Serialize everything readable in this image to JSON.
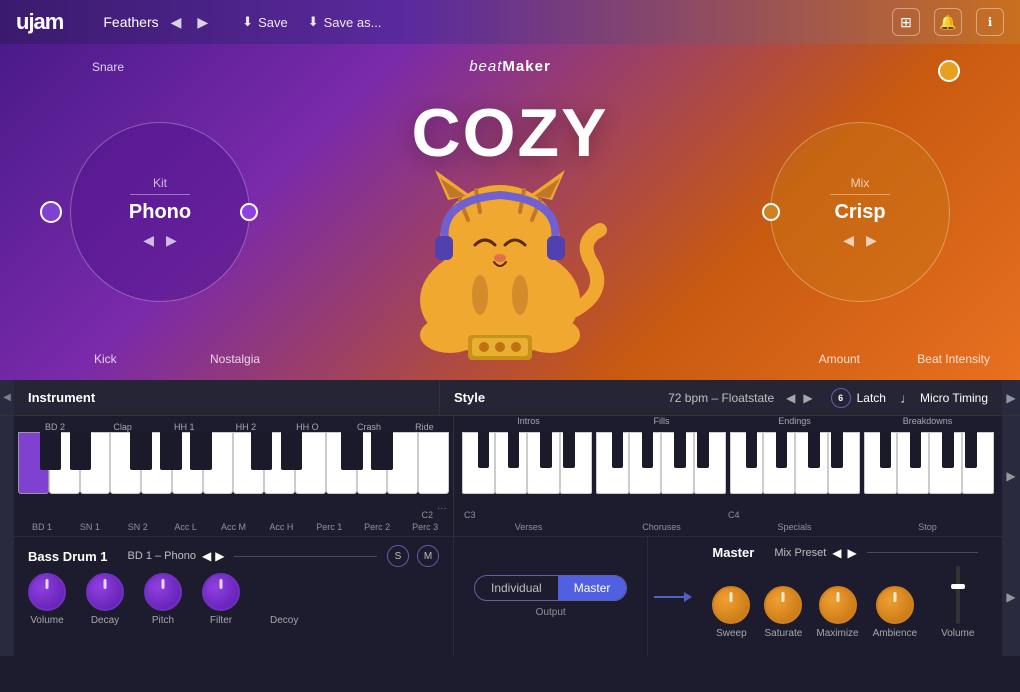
{
  "topbar": {
    "logo": "ujam",
    "preset_name": "Feathers",
    "save_label": "Save",
    "save_as_label": "Save as...",
    "icons": [
      "grid-icon",
      "bell-icon",
      "info-icon"
    ]
  },
  "hero": {
    "beatmaker_label": "beatMaker",
    "product_name": "COZY",
    "kit_label": "Kit",
    "kit_name": "Phono",
    "mix_label": "Mix",
    "mix_name": "Crisp",
    "snare_label": "Snare",
    "kick_label": "Kick",
    "nostalgia_label": "Nostalgia",
    "amount_label": "Amount",
    "beat_intensity_label": "Beat Intensity"
  },
  "instrument": {
    "title": "Instrument",
    "key_labels": [
      "BD 2",
      "Clap",
      "HH 1",
      "HH 2",
      "HH O",
      "Crash",
      "Ride"
    ],
    "bottom_labels": [
      "BD 1",
      "SN 1",
      "SN 2",
      "Acc L",
      "Acc M",
      "Acc H",
      "Perc 1",
      "Perc 2",
      "Perc 3"
    ],
    "c2_label": "C2"
  },
  "style": {
    "title": "Style",
    "bpm": "72 bpm – Floatstate",
    "latch_label": "Latch",
    "micro_timing_label": "Micro Timing",
    "section_labels": [
      "Intros",
      "Fills",
      "Endings",
      "Breakdowns"
    ],
    "bottom_labels": [
      "Verses",
      "Choruses",
      "Specials",
      "Stop"
    ],
    "c3_label": "C3",
    "c4_label": "C4"
  },
  "bass_drum": {
    "title": "Bass Drum 1",
    "preset": "BD 1 – Phono",
    "knobs": [
      "Volume",
      "Decay",
      "Pitch",
      "Filter"
    ],
    "s_label": "S",
    "m_label": "M"
  },
  "output": {
    "individual_label": "Individual",
    "master_label": "Master",
    "output_label": "Output"
  },
  "master": {
    "title": "Master",
    "mix_preset_label": "Mix Preset",
    "knobs": [
      "Sweep",
      "Saturate",
      "Maximize",
      "Ambience",
      "Volume"
    ]
  },
  "decoy": {
    "label": "Decoy"
  },
  "pitch": {
    "label": "Pitch"
  }
}
